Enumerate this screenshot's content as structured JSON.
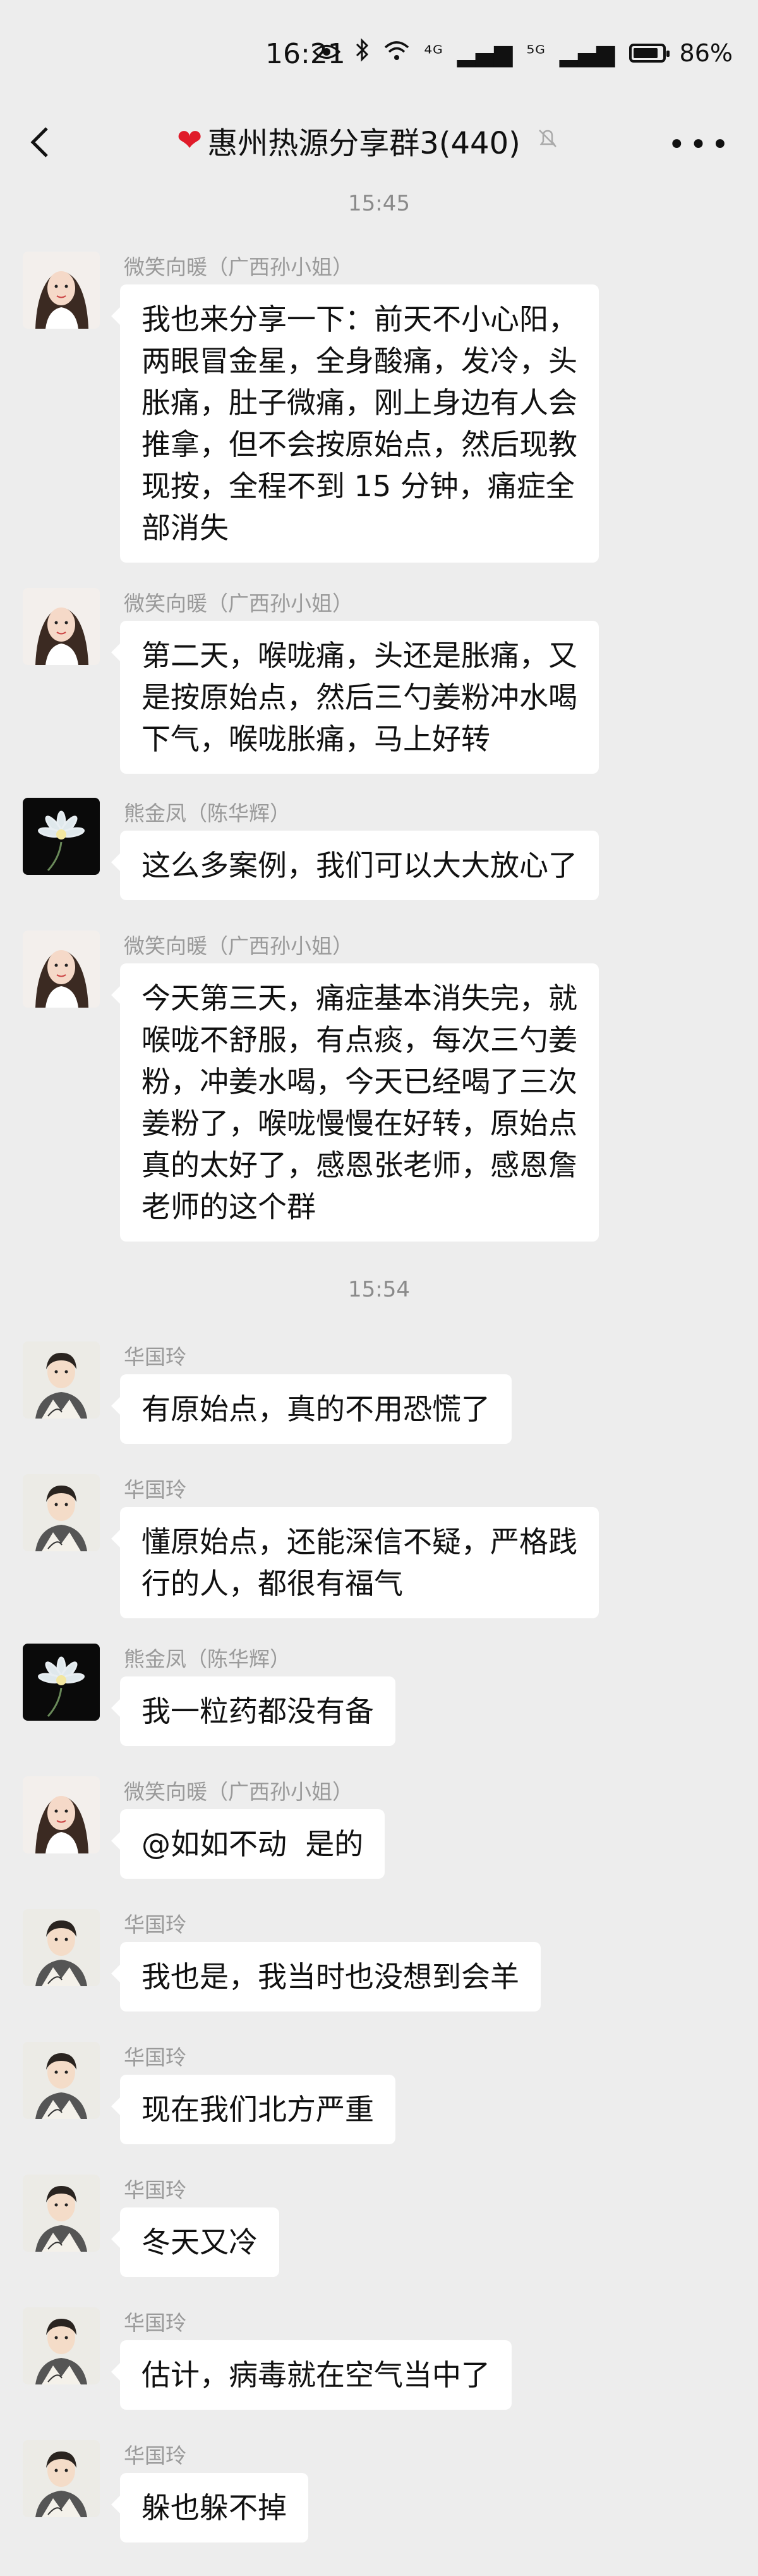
{
  "status_bar": {
    "time": "16:21",
    "signal1": "⁴ᴳ",
    "signal2": "⁵ᴳ",
    "battery": "86%",
    "battery_level": 0.86
  },
  "nav": {
    "title": "惠州热源分享群3(440)"
  },
  "timestamps": [
    "15:45",
    "15:54"
  ],
  "messages": [
    {
      "sender": "微笑向暖（广西孙小姐）",
      "avatar": "woman",
      "text": "我也来分享一下：前天不小心阳，\n两眼冒金星，全身酸痛，发冷，头\n胀痛，肚子微痛，刚上身边有人会\n推拿，但不会按原始点，然后现教\n现按，全程不到 15 分钟，痛症全\n部消失"
    },
    {
      "sender": "微笑向暖（广西孙小姐）",
      "avatar": "woman",
      "text": "第二天，喉咙痛，头还是胀痛，又\n是按原始点，然后三勺姜粉冲水喝\n下气，喉咙胀痛，马上好转"
    },
    {
      "sender": "熊金凤（陈华辉）",
      "avatar": "flower",
      "text": "这么多案例，我们可以大大放心了"
    },
    {
      "sender": "微笑向暖（广西孙小姐）",
      "avatar": "woman",
      "text": "今天第三天，痛症基本消失完，就\n喉咙不舒服，有点痰，每次三勺姜\n粉，冲姜水喝，今天已经喝了三次\n姜粉了，喉咙慢慢在好转，原始点\n真的太好了，感恩张老师，感恩詹\n老师的这个群"
    },
    {
      "sender": "华国玲",
      "avatar": "man",
      "text": "有原始点，真的不用恐慌了"
    },
    {
      "sender": "华国玲",
      "avatar": "man",
      "text": "懂原始点，还能深信不疑，严格践\n行的人，都很有福气"
    },
    {
      "sender": "熊金凤（陈华辉）",
      "avatar": "flower",
      "text": "我一粒药都没有备"
    },
    {
      "sender": "微笑向暖（广西孙小姐）",
      "avatar": "woman",
      "text": "@如如不动  是的"
    },
    {
      "sender": "华国玲",
      "avatar": "man",
      "text": "我也是，我当时也没想到会羊"
    },
    {
      "sender": "华国玲",
      "avatar": "man",
      "text": "现在我们北方严重"
    },
    {
      "sender": "华国玲",
      "avatar": "man",
      "text": "冬天又冷"
    },
    {
      "sender": "华国玲",
      "avatar": "man",
      "text": "估计，病毒就在空气当中了"
    },
    {
      "sender": "华国玲",
      "avatar": "man",
      "text": "躲也躲不掉"
    }
  ]
}
